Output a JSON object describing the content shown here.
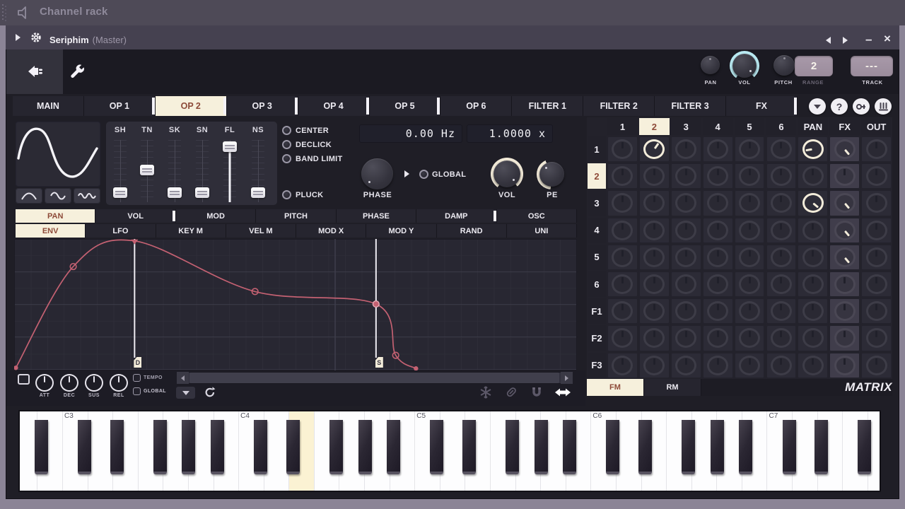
{
  "channel_rack": {
    "title": "Channel rack"
  },
  "plugin": {
    "title": "Seriphim",
    "subtitle": "(Master)",
    "window_buttons": {
      "minimize": "–",
      "close": "×"
    },
    "header": {
      "pan_label": "PAN",
      "vol_label": "VOL",
      "pitch_label": "PITCH",
      "range_label": "RANGE",
      "range_value": "2",
      "track_label": "TRACK",
      "track_value": "---",
      "accent_cyan": "#b9eaf2",
      "accent_cream": "#f2ead8"
    },
    "tabs": {
      "items": [
        "MAIN",
        "OP 1",
        "OP 2",
        "OP 3",
        "OP 4",
        "OP 5",
        "OP 6",
        "FILTER 1",
        "FILTER 2",
        "FILTER 3",
        "FX"
      ],
      "active": "OP 2",
      "meter_after": [
        "OP 1",
        "OP 2",
        "OP 3",
        "OP 4",
        "OP 5",
        "FX"
      ]
    },
    "corner_buttons": {
      "help": "?"
    }
  },
  "operator": {
    "shape_sliders": {
      "labels": [
        "SH",
        "TN",
        "SK",
        "SN",
        "FL",
        "NS"
      ],
      "values": [
        0.08,
        0.52,
        0.08,
        0.08,
        0.97,
        0.08
      ],
      "filled_track": "FL"
    },
    "toggles": [
      "CENTER",
      "DECLICK",
      "BAND LIMIT"
    ],
    "pluck_label": "PLUCK",
    "freq_value": "0.00 Hz",
    "ratio_value": "1.0000 x",
    "phase_label": "PHASE",
    "global_label": "GLOBAL",
    "vol_label": "VOL",
    "pe_label": "PE"
  },
  "mod_section": {
    "target_tabs": {
      "items": [
        "PAN",
        "VOL",
        "MOD",
        "PITCH",
        "PHASE",
        "DAMP",
        "OSC"
      ],
      "active": "PAN",
      "meter_after": [
        "VOL",
        "DAMP"
      ]
    },
    "shape_tabs": {
      "items": [
        "ENV",
        "LFO",
        "KEY M",
        "VEL M",
        "MOD X",
        "MOD Y",
        "RAND",
        "UNI"
      ],
      "active": "ENV",
      "meter_after": []
    }
  },
  "envelope": {
    "color": "#c46172",
    "points": [
      {
        "x": 0.003,
        "y": 0.98,
        "type": "start"
      },
      {
        "x": 0.105,
        "y": 0.21,
        "type": "tension"
      },
      {
        "x": 0.214,
        "y": 0.015,
        "type": "peak"
      },
      {
        "x": 0.428,
        "y": 0.4,
        "type": "tension"
      },
      {
        "x": 0.643,
        "y": 0.495,
        "type": "sustain"
      },
      {
        "x": 0.678,
        "y": 0.885,
        "type": "tension"
      },
      {
        "x": 0.714,
        "y": 0.985,
        "type": "end"
      }
    ],
    "markers": [
      {
        "label": "D",
        "x": 0.214
      },
      {
        "label": "S",
        "x": 0.643
      }
    ],
    "major_gridline_x": 0.5704,
    "adsr_knobs": [
      "ATT",
      "DEC",
      "SUS",
      "REL"
    ],
    "tempo_label": "TEMPO",
    "global_label": "GLOBAL"
  },
  "matrix": {
    "title": "MATRIX",
    "columns": [
      "1",
      "2",
      "3",
      "4",
      "5",
      "6",
      "PAN",
      "FX",
      "OUT"
    ],
    "rows": [
      "1",
      "2",
      "3",
      "4",
      "5",
      "6",
      "F1",
      "F2",
      "F3"
    ],
    "active_column": "2",
    "active_row": "2",
    "highlight_column": "FX",
    "active_knobs": [
      {
        "row": "1",
        "col": "2",
        "angle": 35
      },
      {
        "row": "1",
        "col": "PAN",
        "angle": -100
      },
      {
        "row": "1",
        "col": "FX",
        "angle": 140
      },
      {
        "row": "3",
        "col": "PAN",
        "angle": 130
      },
      {
        "row": "3",
        "col": "FX",
        "angle": 140
      },
      {
        "row": "4",
        "col": "FX",
        "angle": 140
      },
      {
        "row": "5",
        "col": "FX",
        "angle": 140
      }
    ],
    "mode_tabs": {
      "items": [
        "FM",
        "RM"
      ],
      "active": "FM"
    }
  },
  "keyboard": {
    "octave_labels": [
      "C3",
      "C4",
      "C5",
      "C6",
      "C7"
    ],
    "highlighted_note": "E4"
  },
  "icons": {
    "freeze": "snowflake",
    "link": "paperclip",
    "snap": "magnet",
    "slide": "double-arrow"
  }
}
